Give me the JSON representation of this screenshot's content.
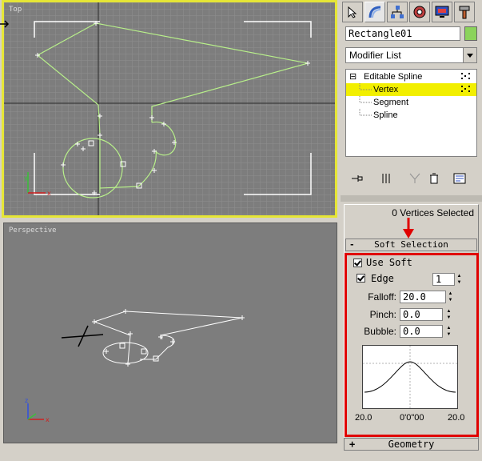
{
  "viewports": {
    "top": {
      "label": "Top"
    },
    "perspective": {
      "label": "Perspective"
    }
  },
  "command_panel": {
    "tabs": [
      "create",
      "modify",
      "hierarchy",
      "motion",
      "display",
      "utilities"
    ],
    "active_tab": "modify",
    "object_name": "Rectangle01",
    "object_color": "#8bd35a",
    "modifier_list": "Modifier List",
    "stack": {
      "root_symbol": "⊟",
      "root": "Editable Spline",
      "items": [
        "Vertex",
        "Segment",
        "Spline"
      ],
      "selected": "Vertex"
    }
  },
  "selection": {
    "status": "0 Vertices Selected"
  },
  "soft_selection": {
    "title": "Soft Selection",
    "collapse_symbol": "-",
    "use_soft": {
      "label": "Use Soft",
      "checked": true
    },
    "edge": {
      "label": "Edge",
      "checked": true,
      "value": "1"
    },
    "falloff": {
      "label": "Falloff:",
      "value": "20.0"
    },
    "pinch": {
      "label": "Pinch:",
      "value": "0.0"
    },
    "bubble": {
      "label": "Bubble:",
      "value": "0.0"
    },
    "curve_labels": {
      "left": "20.0",
      "center": "0'0\"00",
      "right": "20.0"
    }
  },
  "geometry": {
    "title": "Geometry",
    "expand_symbol": "+"
  },
  "colors": {
    "highlight_frame": "#e00000",
    "annotation_arrow": "#e00000",
    "active_viewport_border": "#e6e636",
    "selected_stack_row": "#f2ef00",
    "spline_top": "#b8f08a"
  }
}
